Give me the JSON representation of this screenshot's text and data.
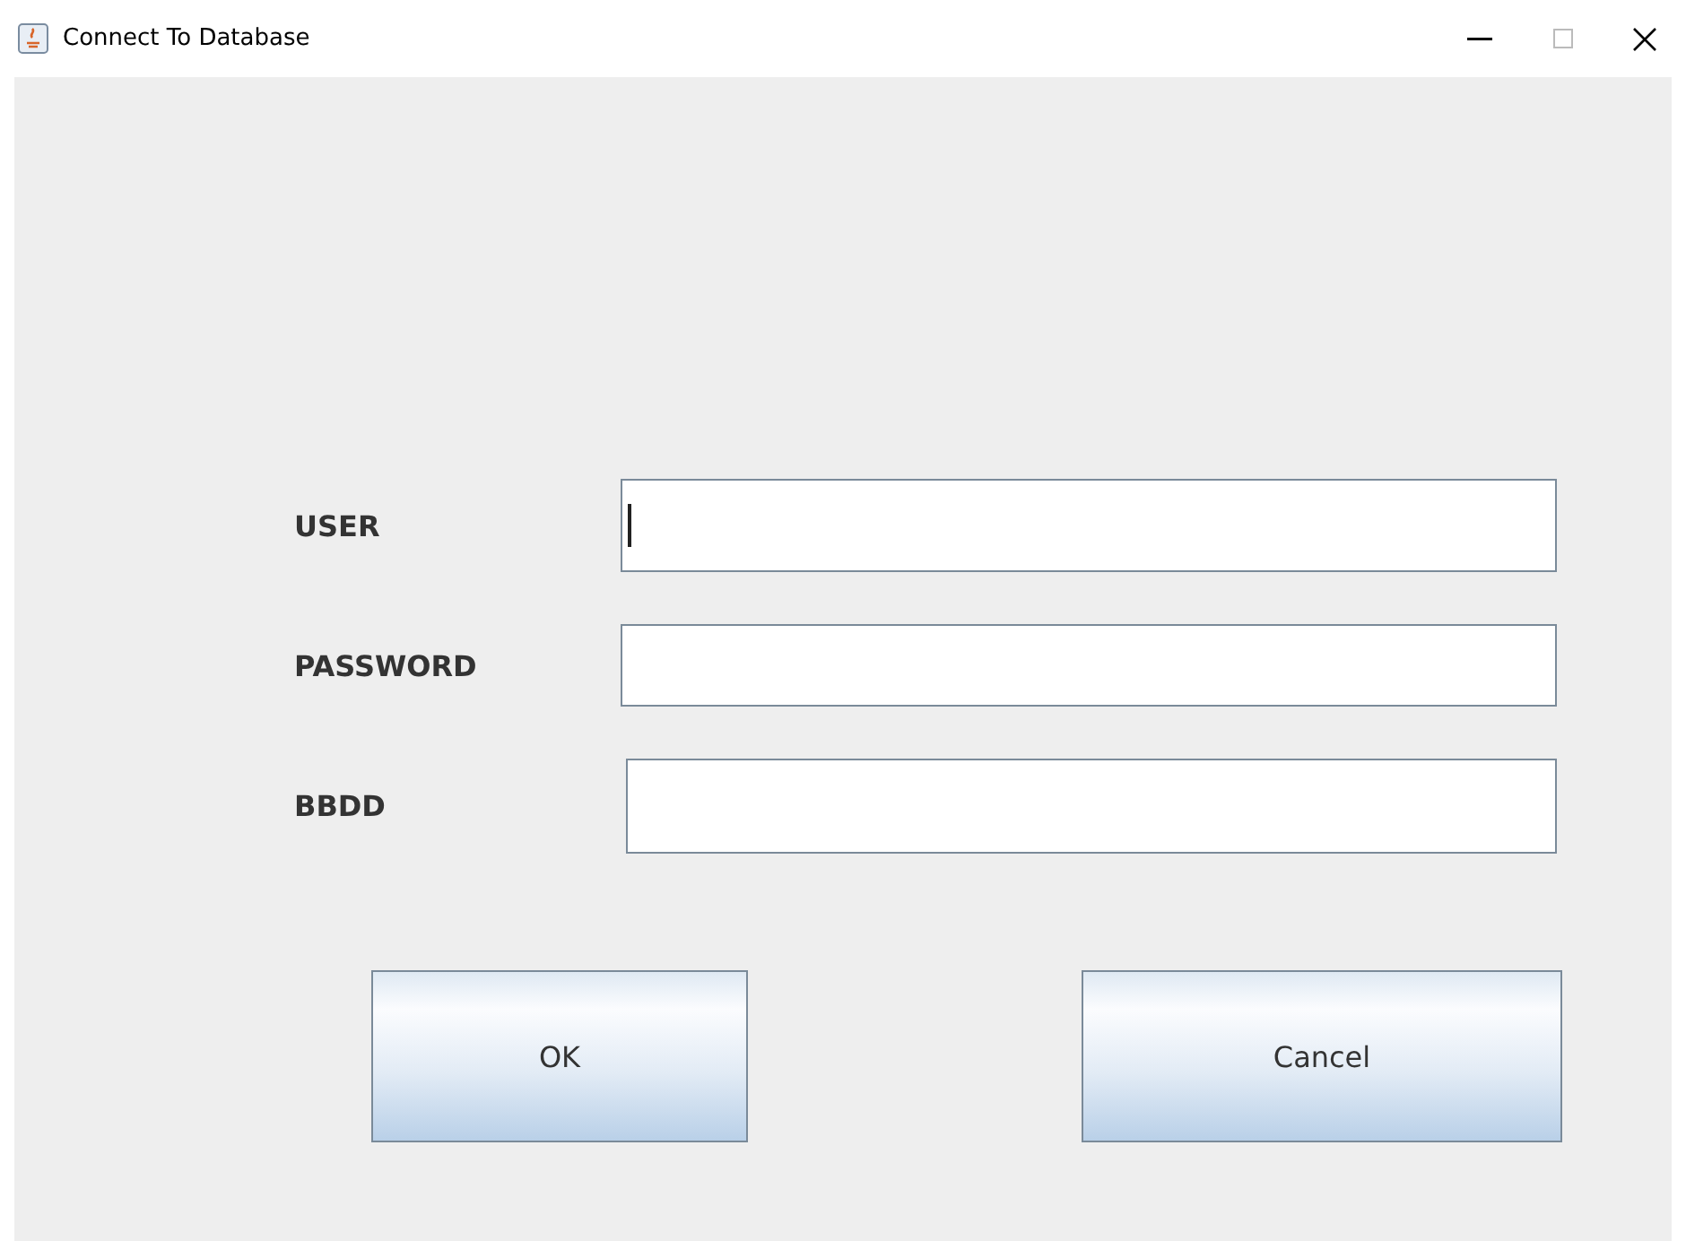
{
  "window": {
    "title": "Connect To Database"
  },
  "fields": [
    {
      "label": "USER",
      "focused": true
    },
    {
      "label": "PASSWORD",
      "focused": false
    },
    {
      "label": "BBDD",
      "focused": false
    }
  ],
  "buttons": [
    "OK",
    "Cancel"
  ]
}
